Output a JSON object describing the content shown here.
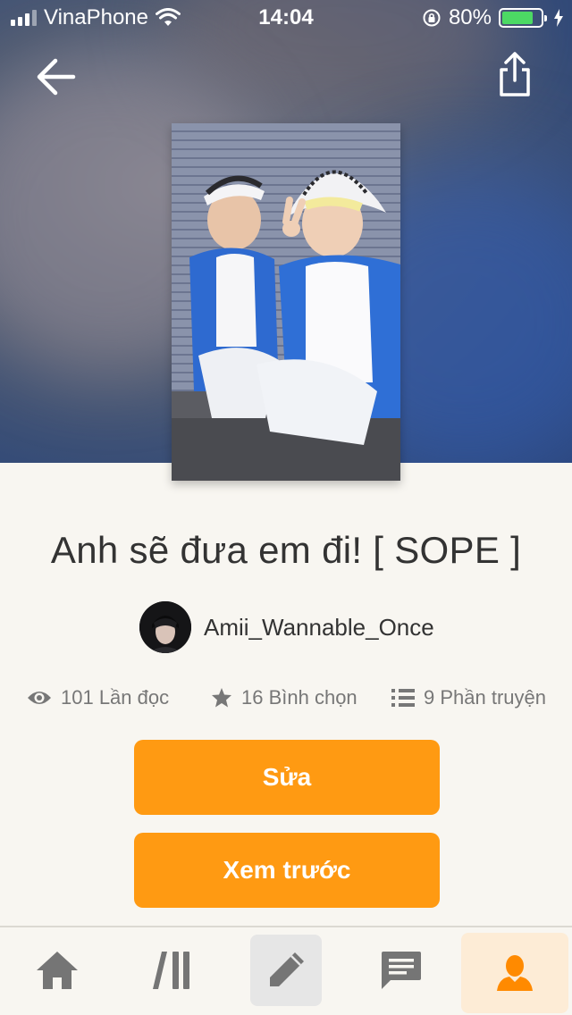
{
  "status_bar": {
    "carrier": "VinaPhone",
    "time": "14:04",
    "battery_percent": "80%",
    "battery_level": 0.8
  },
  "story": {
    "title": "Anh sẽ đưa em đi! [ SOPE ]",
    "author": "Amii_Wannable_Once",
    "reads": "101 Lần đọc",
    "votes": "16 Bình chọn",
    "parts": "9 Phần truyện"
  },
  "actions": {
    "edit_label": "Sửa",
    "preview_label": "Xem trước"
  },
  "nav": {
    "back_icon": "arrow-left-icon",
    "share_icon": "share-icon"
  },
  "tabbar": {
    "items": [
      {
        "icon": "home-icon",
        "active": false
      },
      {
        "icon": "library-icon",
        "active": false
      },
      {
        "icon": "pencil-icon",
        "active": false
      },
      {
        "icon": "chat-icon",
        "active": false
      },
      {
        "icon": "user-icon",
        "active": true
      }
    ]
  },
  "colors": {
    "accent": "#ff9a12",
    "background": "#f8f6f1",
    "profile_tab_bg": "#fdecd6",
    "icon_gray": "#757575"
  }
}
